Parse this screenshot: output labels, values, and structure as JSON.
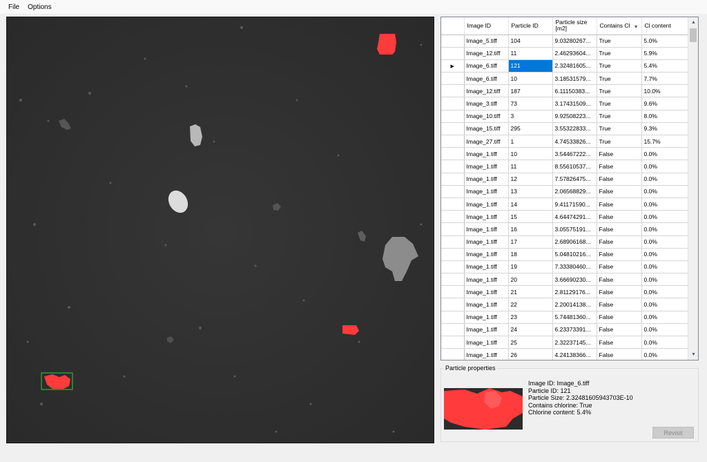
{
  "menu": {
    "file": "File",
    "options": "Options"
  },
  "grid": {
    "headers": [
      "Image ID",
      "Particle ID",
      "Particle size [m2]",
      "Contains Cl",
      "Cl content"
    ],
    "selected_row_index": 2,
    "rows": [
      [
        "Image_5.tiff",
        "104",
        "9.03280267...",
        "True",
        "5.0%"
      ],
      [
        "Image_12.tiff",
        "11",
        "2.46293604...",
        "True",
        "5.9%"
      ],
      [
        "Image_6.tiff",
        "121",
        "2.32481605...",
        "True",
        "5.4%"
      ],
      [
        "Image_6.tiff",
        "10",
        "3.18531579...",
        "True",
        "7.7%"
      ],
      [
        "Image_12.tiff",
        "187",
        "6.11150383...",
        "True",
        "10.0%"
      ],
      [
        "Image_3.tiff",
        "73",
        "3.17431509...",
        "True",
        "9.6%"
      ],
      [
        "Image_10.tiff",
        "3",
        "9.92508223...",
        "True",
        "8.0%"
      ],
      [
        "Image_15.tiff",
        "295",
        "3.55322833...",
        "True",
        "9.3%"
      ],
      [
        "Image_27.tiff",
        "1",
        "4.74533826...",
        "True",
        "15.7%"
      ],
      [
        "Image_1.tiff",
        "10",
        "3.54467222...",
        "False",
        "0.0%"
      ],
      [
        "Image_1.tiff",
        "11",
        "8.55610537...",
        "False",
        "0.0%"
      ],
      [
        "Image_1.tiff",
        "12",
        "7.57826475...",
        "False",
        "0.0%"
      ],
      [
        "Image_1.tiff",
        "13",
        "2.06568829...",
        "False",
        "0.0%"
      ],
      [
        "Image_1.tiff",
        "14",
        "9.41171590...",
        "False",
        "0.0%"
      ],
      [
        "Image_1.tiff",
        "15",
        "4.64474291...",
        "False",
        "0.0%"
      ],
      [
        "Image_1.tiff",
        "16",
        "3.05575191...",
        "False",
        "0.0%"
      ],
      [
        "Image_1.tiff",
        "17",
        "2.68906168...",
        "False",
        "0.0%"
      ],
      [
        "Image_1.tiff",
        "18",
        "5.04810216...",
        "False",
        "0.0%"
      ],
      [
        "Image_1.tiff",
        "19",
        "7.33380460...",
        "False",
        "0.0%"
      ],
      [
        "Image_1.tiff",
        "20",
        "3.66690230...",
        "False",
        "0.0%"
      ],
      [
        "Image_1.tiff",
        "21",
        "2.81129176...",
        "False",
        "0.0%"
      ],
      [
        "Image_1.tiff",
        "22",
        "2.20014138...",
        "False",
        "0.0%"
      ],
      [
        "Image_1.tiff",
        "23",
        "5.74481360...",
        "False",
        "0.0%"
      ],
      [
        "Image_1.tiff",
        "24",
        "6.23373391...",
        "False",
        "0.0%"
      ],
      [
        "Image_1.tiff",
        "25",
        "2.32237145...",
        "False",
        "0.0%"
      ],
      [
        "Image_1.tiff",
        "26",
        "4.24138366...",
        "False",
        "0.0%"
      ]
    ]
  },
  "properties": {
    "legend": "Particle properties",
    "lines": [
      "Image ID: Image_6.tiff",
      "Particle ID: 121",
      "Particle Size: 2.32481605943703E-10",
      "Contains chlorine: True",
      "Chlorine content: 5.4%"
    ],
    "revisit_label": "Revisit"
  },
  "colors": {
    "highlight": "#ff3b3b",
    "selection": "#0078d7",
    "bounding_box": "#36c93a"
  }
}
